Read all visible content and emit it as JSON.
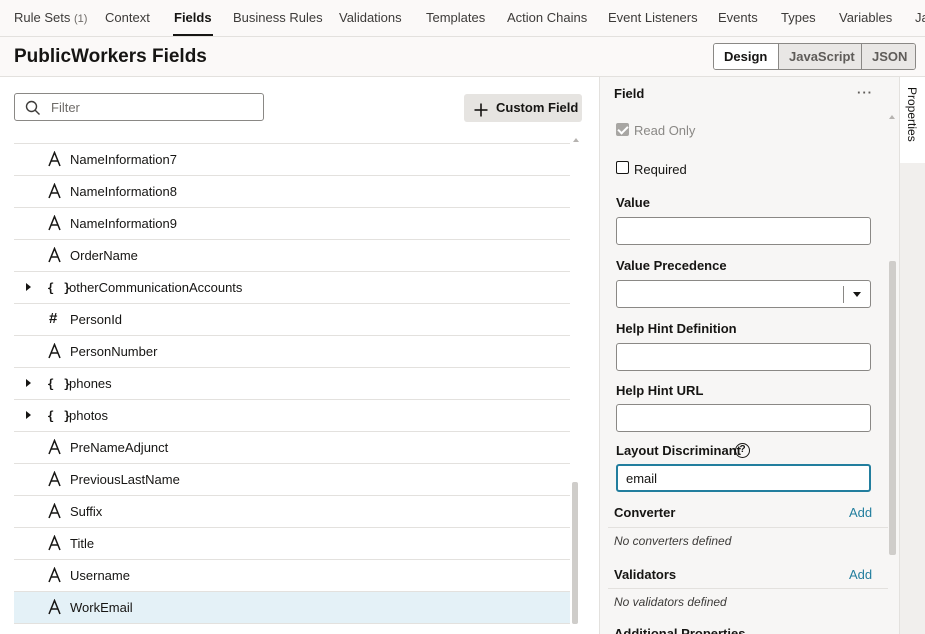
{
  "tabs": [
    {
      "label": "Rule Sets",
      "count": "(1)",
      "active": false
    },
    {
      "label": "Context",
      "active": false
    },
    {
      "label": "Fields",
      "active": true
    },
    {
      "label": "Business Rules",
      "active": false
    },
    {
      "label": "Validations",
      "active": false
    },
    {
      "label": "Templates",
      "active": false
    },
    {
      "label": "Action Chains",
      "active": false
    },
    {
      "label": "Event Listeners",
      "active": false
    },
    {
      "label": "Events",
      "active": false
    },
    {
      "label": "Types",
      "active": false
    },
    {
      "label": "Variables",
      "active": false
    },
    {
      "label": "Ja",
      "active": false
    }
  ],
  "header": {
    "title": "PublicWorkers Fields",
    "view_modes": [
      "Design",
      "JavaScript",
      "JSON"
    ],
    "active_view": "Design"
  },
  "left": {
    "filter_placeholder": "Filter",
    "custom_field_label": "Custom Field",
    "fields": [
      {
        "name": "NameInformation7",
        "type": "text",
        "expandable": false
      },
      {
        "name": "NameInformation8",
        "type": "text",
        "expandable": false
      },
      {
        "name": "NameInformation9",
        "type": "text",
        "expandable": false
      },
      {
        "name": "OrderName",
        "type": "text",
        "expandable": false
      },
      {
        "name": "otherCommunicationAccounts",
        "type": "object",
        "expandable": true
      },
      {
        "name": "PersonId",
        "type": "number",
        "expandable": false
      },
      {
        "name": "PersonNumber",
        "type": "text",
        "expandable": false
      },
      {
        "name": "phones",
        "type": "object",
        "expandable": true
      },
      {
        "name": "photos",
        "type": "object",
        "expandable": true
      },
      {
        "name": "PreNameAdjunct",
        "type": "text",
        "expandable": false
      },
      {
        "name": "PreviousLastName",
        "type": "text",
        "expandable": false
      },
      {
        "name": "Suffix",
        "type": "text",
        "expandable": false
      },
      {
        "name": "Title",
        "type": "text",
        "expandable": false
      },
      {
        "name": "Username",
        "type": "text",
        "expandable": false
      },
      {
        "name": "WorkEmail",
        "type": "text",
        "expandable": false,
        "selected": true
      }
    ]
  },
  "properties": {
    "title": "Field",
    "more": "···",
    "read_only_label": "Read Only",
    "read_only_checked": true,
    "required_label": "Required",
    "required_checked": false,
    "value_label": "Value",
    "value": "",
    "value_precedence_label": "Value Precedence",
    "help_hint_definition_label": "Help Hint Definition",
    "help_hint_url_label": "Help Hint URL",
    "layout_discriminant_label": "Layout Discriminant",
    "help_icon": "?",
    "layout_discriminant_value": "email",
    "converter_label": "Converter",
    "converter_add": "Add",
    "converter_empty": "No converters defined",
    "validators_label": "Validators",
    "validators_add": "Add",
    "validators_empty": "No validators defined",
    "additional_label": "Additional Properties"
  },
  "side_tab": {
    "label": "Properties"
  },
  "colors": {
    "accent": "#227e9e",
    "selected_row": "#e4f1f7",
    "panel_bg": "#f7f6f5"
  }
}
